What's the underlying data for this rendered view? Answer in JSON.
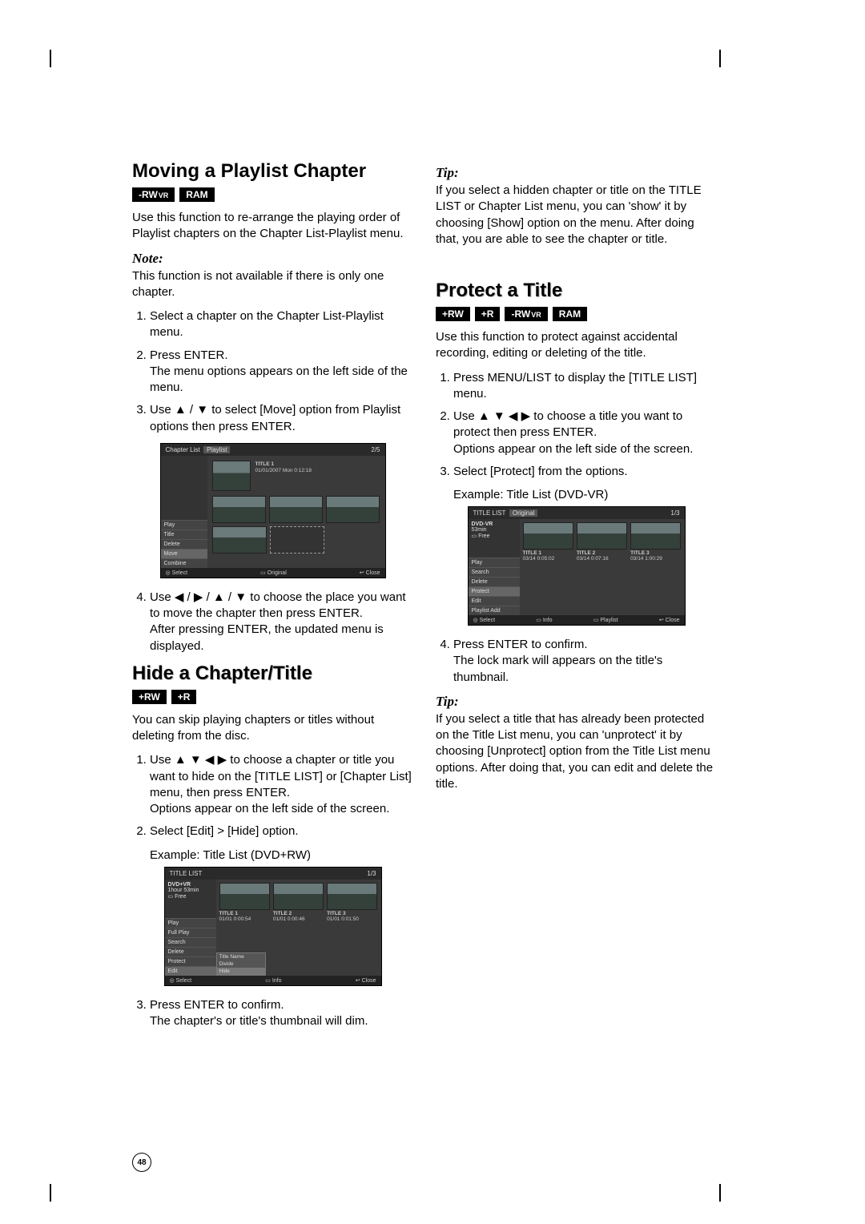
{
  "page_number": "48",
  "badges": {
    "rwvr": "-RW",
    "rwvr_sub": "VR",
    "ram": "RAM",
    "plus_rw": "+RW",
    "plus_r": "+R"
  },
  "moving": {
    "heading": "Moving a Playlist Chapter",
    "intro": "Use this function to re-arrange the playing order of Playlist chapters on the Chapter List-Playlist menu.",
    "note_label": "Note:",
    "note_body": "This function is not available if there is only one chapter.",
    "steps": [
      "Select a chapter on the Chapter List-Playlist menu.",
      "Press ENTER.\nThe menu options appears on the left side of the menu.",
      "Use ▲ / ▼ to select [Move] option from Playlist options then press ENTER.",
      "Use ◀ / ▶ / ▲ / ▼ to choose the place you want to move the chapter then press ENTER.\nAfter pressing ENTER, the updated menu is displayed."
    ],
    "ss": {
      "header_left": "Chapter List",
      "header_tab": "Playlist",
      "header_right": "2/5",
      "title_line1": "TITLE 1",
      "title_line2": "01/01/2007  Mon   0:12:18",
      "side": [
        "Play",
        "Title",
        "Delete",
        "Move",
        "Combine"
      ],
      "footer_select": "Select",
      "footer_original": "Original",
      "footer_close": "Close"
    }
  },
  "hide": {
    "heading": "Hide a Chapter/Title",
    "intro": "You can skip playing chapters or titles without deleting from the disc.",
    "steps": [
      "Use ▲ ▼ ◀ ▶ to choose a chapter or title you want to hide on the [TITLE LIST] or [Chapter List] menu, then press ENTER.\nOptions appear on the left side of the screen.",
      "Select [Edit] > [Hide] option.",
      "Press ENTER to confirm.\nThe chapter's or title's thumbnail will dim."
    ],
    "example_label": "Example: Title List (DVD+RW)",
    "ss": {
      "header_left": "TITLE LIST",
      "header_right": "1/3",
      "disc": "DVD+VR",
      "info1": "1hour 53min",
      "info2": "Free",
      "side": [
        "Play",
        "Full Play",
        "Search",
        "Delete",
        "Protect",
        "Edit"
      ],
      "submenu": [
        "Title Name",
        "Divide",
        "Hide"
      ],
      "cells": [
        {
          "t": "TITLE 1",
          "d": "01/01    0:00:54"
        },
        {
          "t": "TITLE 2",
          "d": "01/01    0:00:46"
        },
        {
          "t": "TITLE 3",
          "d": "01/01    0:01:50"
        }
      ],
      "footer_select": "Select",
      "footer_info": "Info",
      "footer_close": "Close"
    }
  },
  "tip1": {
    "label": "Tip:",
    "body": "If you select a hidden chapter or title on the TITLE LIST or Chapter List menu, you can 'show' it by choosing [Show] option on the menu. After doing that, you are able to see the chapter or title."
  },
  "protect": {
    "heading": "Protect a Title",
    "intro": "Use this function to protect against accidental recording, editing or deleting of the title.",
    "steps": [
      "Press MENU/LIST to display the [TITLE LIST] menu.",
      "Use ▲ ▼ ◀ ▶ to choose a title you want to protect then press ENTER.\nOptions appear on the left side of the screen.",
      "Select [Protect] from the options.",
      "Press ENTER to confirm.\nThe lock mark will appears on the title's thumbnail."
    ],
    "example_label": "Example: Title List (DVD-VR)",
    "ss": {
      "header_left": "TITLE LIST",
      "header_tab": "Original",
      "header_right": "1/3",
      "disc": "DVD-VR",
      "info1": "53min",
      "info2": "Free",
      "side": [
        "Play",
        "Search",
        "Delete",
        "Protect",
        "Edit",
        "Playlist Add"
      ],
      "cells": [
        {
          "t": "TITLE 1",
          "d": "03/14    0:05:02"
        },
        {
          "t": "TITLE 2",
          "d": "03/14    0:07:16"
        },
        {
          "t": "TITLE 3",
          "d": "03/14    1:00:29"
        }
      ],
      "footer_select": "Select",
      "footer_info": "Info",
      "footer_playlist": "Playlist",
      "footer_close": "Close"
    }
  },
  "tip2": {
    "label": "Tip:",
    "body": "If you select a title that has already been protected on the Title List menu, you can 'unprotect' it by choosing [Unprotect] option from the Title List menu options. After doing that, you can edit and delete the title."
  }
}
